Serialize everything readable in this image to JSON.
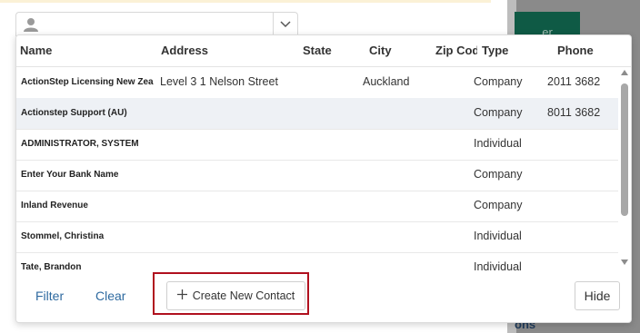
{
  "background": {
    "right_button_label": "er",
    "right_bottom_text": "ons"
  },
  "contact_select": {
    "icon": "person-icon",
    "chevron": "chevron-down-icon"
  },
  "table": {
    "columns": [
      "Name",
      "Address",
      "State",
      "City",
      "Zip Code",
      "Type",
      "Phone"
    ],
    "rows": [
      {
        "name": "ActionStep Licensing New Zealand",
        "address": "Level 3 1 Nelson Street",
        "state": "",
        "city": "Auckland",
        "zip": "",
        "type": "Company",
        "phone": "2011 3682"
      },
      {
        "name": "Actionstep Support (AU)",
        "address": "",
        "state": "",
        "city": "",
        "zip": "",
        "type": "Company",
        "phone": "8011 3682"
      },
      {
        "name": "ADMINISTRATOR, SYSTEM",
        "address": "",
        "state": "",
        "city": "",
        "zip": "",
        "type": "Individual",
        "phone": ""
      },
      {
        "name": "Enter Your Bank Name",
        "address": "",
        "state": "",
        "city": "",
        "zip": "",
        "type": "Company",
        "phone": ""
      },
      {
        "name": "Inland Revenue",
        "address": "",
        "state": "",
        "city": "",
        "zip": "",
        "type": "Company",
        "phone": ""
      },
      {
        "name": "Stommel, Christina",
        "address": "",
        "state": "",
        "city": "",
        "zip": "",
        "type": "Individual",
        "phone": ""
      },
      {
        "name": "Tate, Brandon",
        "address": "",
        "state": "",
        "city": "",
        "zip": "",
        "type": "Individual",
        "phone": ""
      }
    ]
  },
  "footer": {
    "filter_label": "Filter",
    "clear_label": "Clear",
    "create_label": "Create New Contact",
    "create_icon": "plus-icon",
    "hide_label": "Hide"
  },
  "colors": {
    "link": "#2e6aa0",
    "highlight_border": "#b0101e",
    "selected_row": "#eef1f5"
  }
}
